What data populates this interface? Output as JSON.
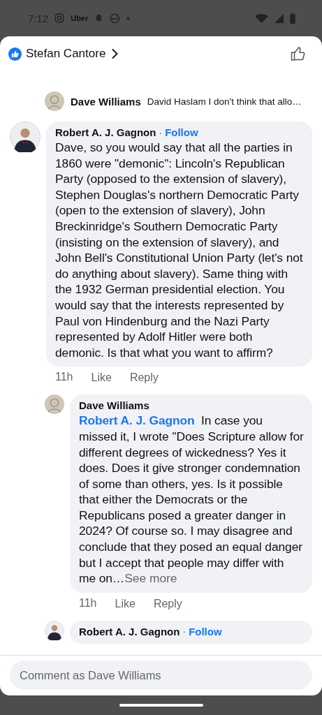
{
  "status_bar": {
    "time": "7:12",
    "app_label": "Uber"
  },
  "header": {
    "title": "Stefan Cantore"
  },
  "collapsed_reply": {
    "author": "Dave Williams",
    "preview": "David Haslam I don't think that allo…"
  },
  "comments": [
    {
      "author": "Robert A. J. Gagnon",
      "separator": "·",
      "follow": "Follow",
      "nested": false,
      "text": "Dave, so you would say that all the parties in 1860 were \"demonic\": Lincoln's Republican Party (opposed to the extension of slavery), Stephen Douglas's northern Democratic Party (open to the extension of slavery), John Breckinridge's Southern Democratic Party (insisting on the extension of slavery), and John Bell's Constitutional Union Party (let's not do anything about slavery). Same thing with the 1932 German presidential election. You would say that the interests represented by Paul von Hindenburg and the Nazi Party represented by Adolf Hitler were both demonic. Is that what you want to affirm?",
      "time": "11h",
      "like": "Like",
      "reply": "Reply"
    },
    {
      "author": "Dave Williams",
      "nested": true,
      "mention": "Robert A. J. Gagnon",
      "text": "In case you missed it, I wrote \"Does Scripture allow for different degrees of wickedness? Yes it does. Does it give stronger condemnation of some than others, yes. Is it possible that either the Democrats or the Republicans posed a greater danger in 2024?  Of course so.  I may disagree and conclude that they posed an equal danger but I accept that people may differ with me on…",
      "see_more": "See more",
      "time": "11h",
      "like": "Like",
      "reply": "Reply"
    },
    {
      "author": "Robert A. J. Gagnon",
      "separator": "·",
      "follow": "Follow",
      "nested": true
    }
  ],
  "composer": {
    "placeholder": "Comment as Dave Williams"
  }
}
